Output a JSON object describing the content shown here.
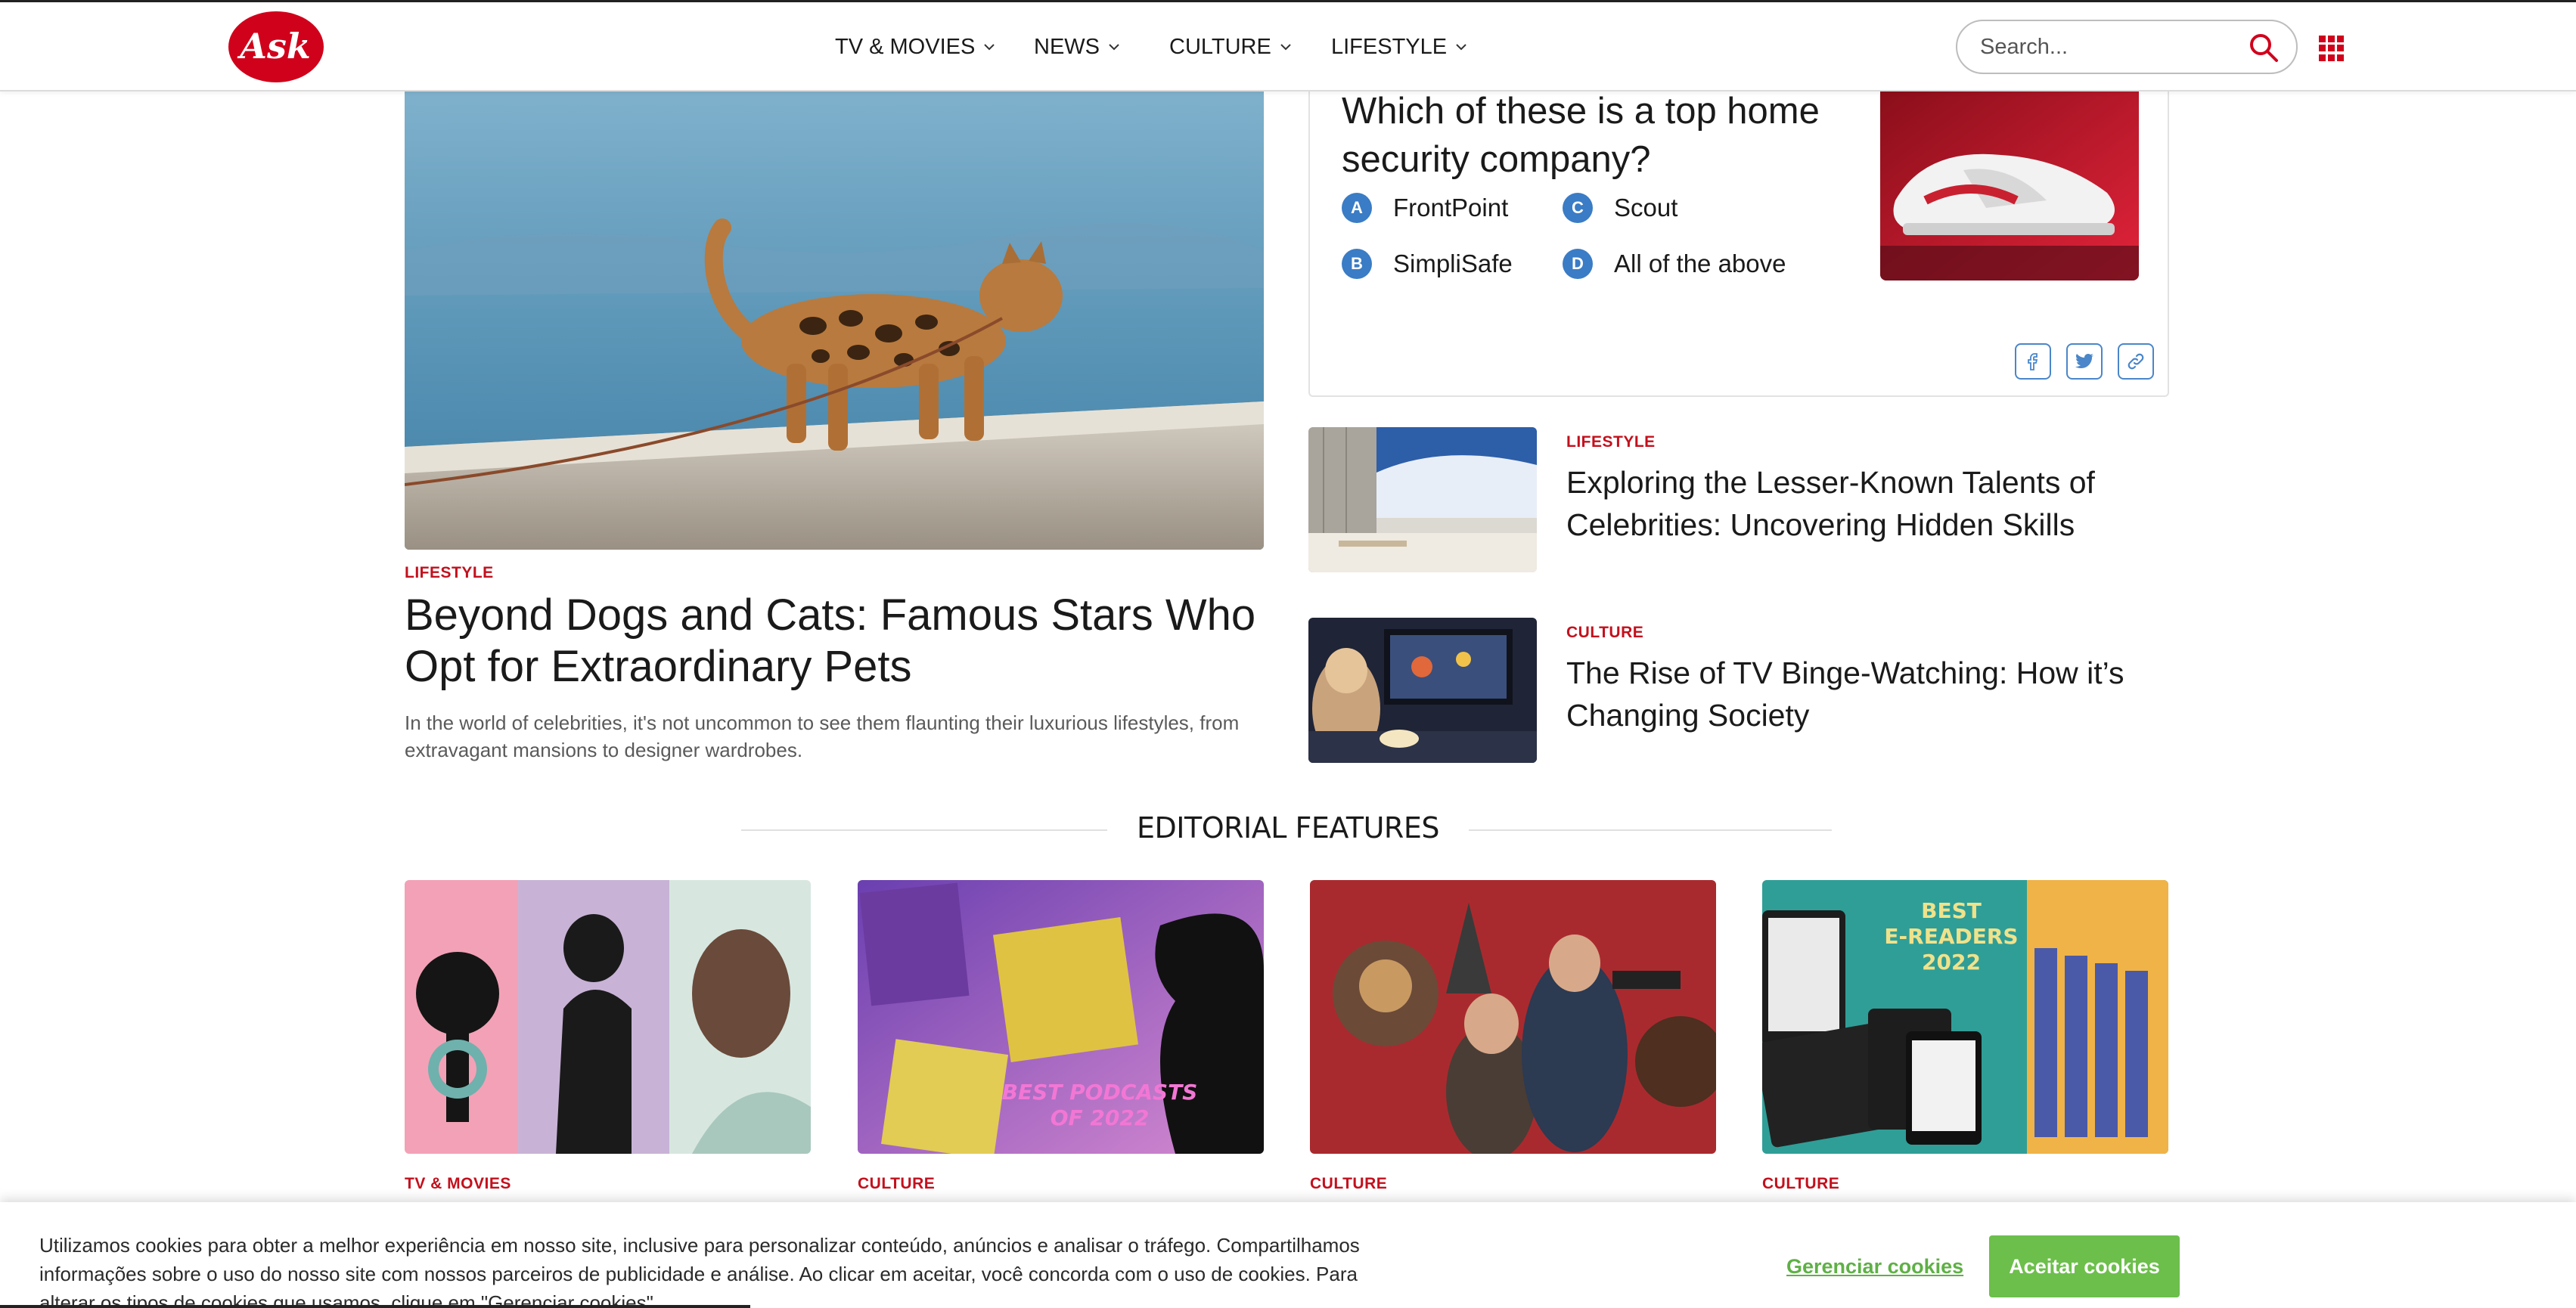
{
  "header": {
    "logo_text": "Ask",
    "nav": [
      {
        "label": "TV & MOVIES"
      },
      {
        "label": "NEWS"
      },
      {
        "label": "CULTURE"
      },
      {
        "label": "LIFESTYLE"
      }
    ],
    "search_placeholder": "Search...",
    "brand_color": "#d0021b"
  },
  "hero": {
    "category": "LIFESTYLE",
    "title": "Beyond Dogs and Cats: Famous Stars Who Opt for Extraordinary Pets",
    "description": "In the world of celebrities, it's not uncommon to see them flaunting their luxurious lifestyles, from extravagant mansions to designer wardrobes."
  },
  "quiz": {
    "question": "Which of these is a top home security company?",
    "options": [
      {
        "letter": "A",
        "text": "FrontPoint"
      },
      {
        "letter": "B",
        "text": "SimpliSafe"
      },
      {
        "letter": "C",
        "text": "Scout"
      },
      {
        "letter": "D",
        "text": "All of the above"
      }
    ],
    "share_icons": [
      "facebook-icon",
      "twitter-icon",
      "link-icon"
    ]
  },
  "side_articles": [
    {
      "category": "LIFESTYLE",
      "title": "Exploring the Lesser-Known Talents of Celebrities: Uncovering Hidden Skills"
    },
    {
      "category": "CULTURE",
      "title": "The Rise of TV Binge-Watching: How it’s Changing Society"
    }
  ],
  "editorial": {
    "heading": "EDITORIAL FEATURES",
    "cards": [
      {
        "category": "TV & MOVIES"
      },
      {
        "category": "CULTURE",
        "image_text": "BEST PODCASTS OF 2022"
      },
      {
        "category": "CULTURE"
      },
      {
        "category": "CULTURE",
        "image_text": "BEST E-READERS 2022"
      }
    ]
  },
  "cookie": {
    "text": "Utilizamos cookies para obter a melhor experiência em nosso site, inclusive para personalizar conteúdo, anúncios e analisar o tráfego. Compartilhamos informações sobre o uso do nosso site com nossos parceiros de publicidade e análise. Ao clicar em aceitar, você concorda com o uso de cookies. Para alterar os tipos de cookies que usamos, clique em \"Gerenciar cookies\".",
    "manage_label": "Gerenciar cookies",
    "accept_label": "Aceitar cookies",
    "accent_color": "#6cbf4b"
  }
}
